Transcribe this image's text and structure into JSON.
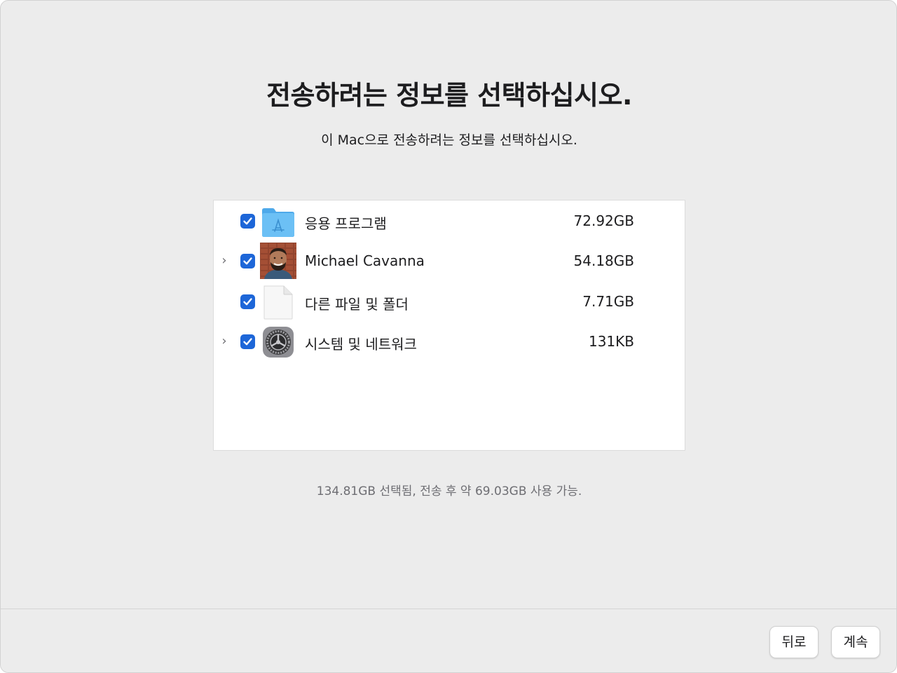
{
  "window": {
    "title": "전송하려는 정보를 선택하십시오.",
    "subtitle": "이 Mac으로 전송하려는 정보를 선택하십시오."
  },
  "items": [
    {
      "label": "응용 프로그램",
      "size": "72.92GB",
      "checked": true,
      "expandable": false,
      "icon": "applications-folder-icon"
    },
    {
      "label": "Michael Cavanna",
      "size": "54.18GB",
      "checked": true,
      "expandable": true,
      "icon": "user-avatar"
    },
    {
      "label": "다른 파일 및 폴더",
      "size": "7.71GB",
      "checked": true,
      "expandable": false,
      "icon": "document-icon"
    },
    {
      "label": "시스템 및 네트워크",
      "size": "131KB",
      "checked": true,
      "expandable": true,
      "icon": "system-settings-gear-icon"
    }
  ],
  "status": "134.81GB 선택됨, 전송 후 약 69.03GB 사용 가능.",
  "buttons": {
    "back": "뒤로",
    "continue": "계속"
  },
  "colors": {
    "checkbox": "#1d66d8",
    "window_bg": "#ececec",
    "list_bg": "#ffffff",
    "folder": "#5ab5f0"
  }
}
